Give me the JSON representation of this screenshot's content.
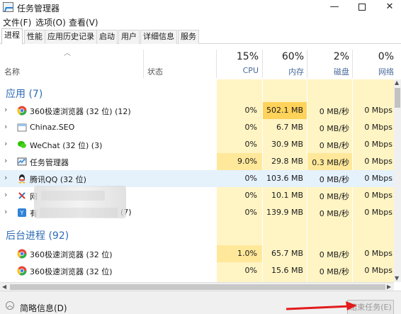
{
  "window": {
    "title": "任务管理器"
  },
  "menu": [
    "文件(F)",
    "选项(O)",
    "查看(V)"
  ],
  "tabs": [
    "进程",
    "性能",
    "应用历史记录",
    "启动",
    "用户",
    "详细信息",
    "服务"
  ],
  "columns": {
    "name": "名称",
    "status": "状态",
    "cpu": {
      "pct": "15%",
      "label": "CPU"
    },
    "mem": {
      "pct": "60%",
      "label": "内存"
    },
    "disk": {
      "pct": "2%",
      "label": "磁盘"
    },
    "net": {
      "pct": "0%",
      "label": "网络"
    }
  },
  "groups": {
    "apps": "应用 (7)",
    "background": "后台进程 (92)"
  },
  "rows": [
    {
      "name": "360极速浏览器 (32 位) (12)",
      "cpu": "0%",
      "mem": "502.1 MB",
      "disk": "0 MB/秒",
      "net": "0 Mbps",
      "icon": "chrome-icon"
    },
    {
      "name": "Chinaz.SEO",
      "cpu": "0%",
      "mem": "6.7 MB",
      "disk": "0 MB/秒",
      "net": "0 Mbps",
      "icon": "app-icon"
    },
    {
      "name": "WeChat (32 位) (3)",
      "cpu": "0%",
      "mem": "30.9 MB",
      "disk": "0 MB/秒",
      "net": "0 Mbps",
      "icon": "wechat-icon"
    },
    {
      "name": "任务管理器",
      "cpu": "9.0%",
      "mem": "29.8 MB",
      "disk": "0.3 MB/秒",
      "net": "0 Mbps",
      "icon": "taskmgr-icon"
    },
    {
      "name": "腾讯QQ (32 位)",
      "cpu": "0%",
      "mem": "103.6 MB",
      "disk": "0 MB/秒",
      "net": "0 Mbps",
      "icon": "qq-icon"
    },
    {
      "name": "网",
      "cpu": "0%",
      "mem": "10.1 MB",
      "disk": "0 MB/秒",
      "net": "0 Mbps",
      "icon": "tool-icon"
    },
    {
      "name": "有",
      "name_suffix": "(7)",
      "cpu": "0%",
      "mem": "139.9 MB",
      "disk": "0 MB/秒",
      "net": "0 Mbps",
      "icon": "yd-icon"
    },
    {
      "name": "360极速浏览器 (32 位)",
      "cpu": "1.0%",
      "mem": "65.7 MB",
      "disk": "0 MB/秒",
      "net": "0 Mbps",
      "icon": "chrome-icon"
    },
    {
      "name": "360极速浏览器 (32 位)",
      "cpu": "0%",
      "mem": "15.6 MB",
      "disk": "0 MB/秒",
      "net": "0 Mbps",
      "icon": "chrome-icon"
    }
  ],
  "footer": {
    "brief": "简略信息(D)",
    "end_task": "结束任务(E)"
  },
  "colors": {
    "heat_light": "#fff4c4",
    "heat_mid": "#ffe89a",
    "heat_strong": "#ffd25a",
    "group_blue": "#2d6bb4",
    "highlight": "#e5f1fb"
  }
}
